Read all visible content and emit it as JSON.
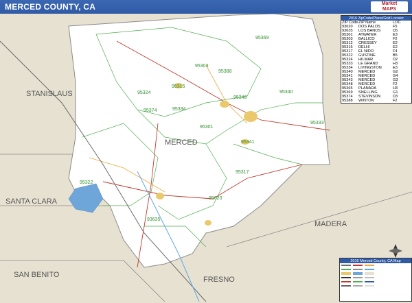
{
  "title": "MERCED COUNTY, CA",
  "brand": {
    "line1": "Market",
    "line2": "MAPS"
  },
  "counties": {
    "stanislaus": "STANISLAUS",
    "merced": "MERCED",
    "santa_clara": "SANTA CLARA",
    "madera": "MADERA",
    "san_benito": "SAN BENITO",
    "fresno": "FRESNO"
  },
  "zip_labels": [
    "95369",
    "95303",
    "95388",
    "95324",
    "95315",
    "95340",
    "95374",
    "95334",
    "95348",
    "95333",
    "95301",
    "95341",
    "95322",
    "95317",
    "95620",
    "93635"
  ],
  "zip_table": {
    "header": "2016 ZipCode/Place/Grid Locator",
    "columns": [
      "ZIP Code",
      "ZIP Name",
      "LOC"
    ],
    "rows": [
      [
        "93620",
        "DOS PALOS",
        "F5"
      ],
      [
        "93635",
        "LOS BANOS",
        "D5"
      ],
      [
        "95301",
        "ATWATER",
        "E3"
      ],
      [
        "95303",
        "BALLICO",
        "F2"
      ],
      [
        "95312",
        "CRESSEY",
        "E2"
      ],
      [
        "95315",
        "DELHI",
        "E2"
      ],
      [
        "95317",
        "EL NIDO",
        "F4"
      ],
      [
        "95322",
        "GUSTINE",
        "B5"
      ],
      [
        "95324",
        "HILMAR",
        "D2"
      ],
      [
        "95333",
        "LE GRAND",
        "H3"
      ],
      [
        "95334",
        "LIVINGSTON",
        "E3"
      ],
      [
        "95340",
        "MERCED",
        "G2"
      ],
      [
        "95341",
        "MERCED",
        "G4"
      ],
      [
        "95343",
        "MERCED",
        "G3"
      ],
      [
        "95348",
        "MERCED",
        "F2"
      ],
      [
        "95365",
        "PLANADA",
        "H3"
      ],
      [
        "95369",
        "SNELLING",
        "G1"
      ],
      [
        "95374",
        "STEVINSON",
        "D3"
      ],
      [
        "95388",
        "WINTON",
        "F2"
      ]
    ]
  },
  "legend": {
    "header": "2016 Merced County, CA Map"
  }
}
